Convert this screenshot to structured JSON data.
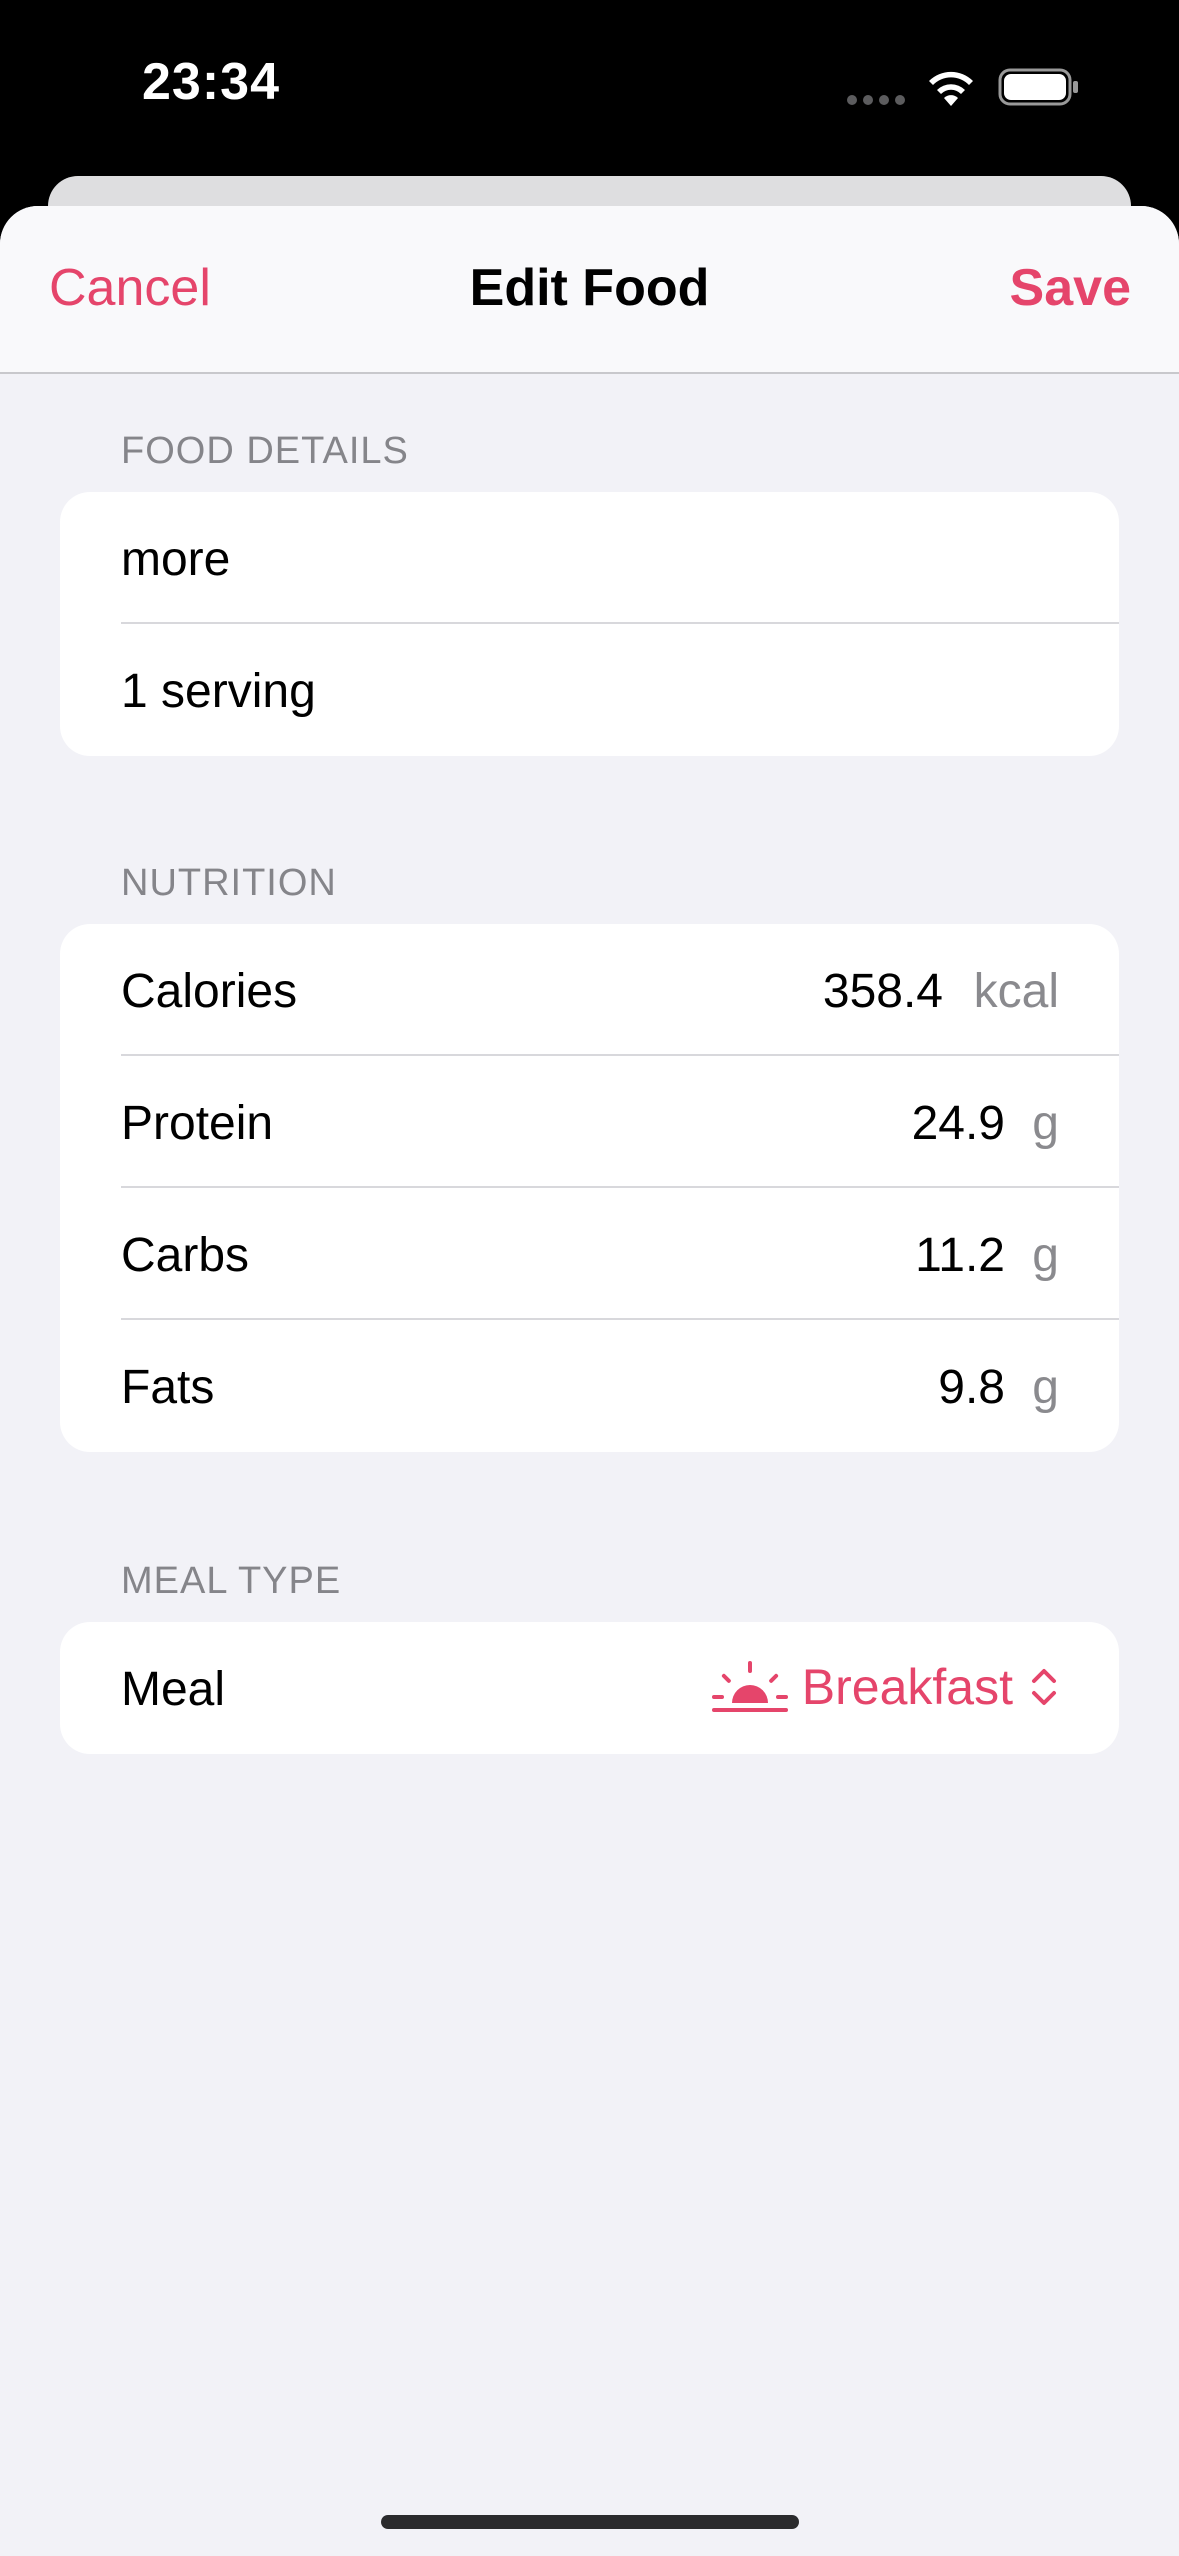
{
  "status_bar": {
    "time": "23:34"
  },
  "nav": {
    "cancel_label": "Cancel",
    "title": "Edit Food",
    "save_label": "Save"
  },
  "food_details": {
    "header": "FOOD DETAILS",
    "name": "more",
    "serving": "1 serving"
  },
  "nutrition": {
    "header": "NUTRITION",
    "rows": [
      {
        "label": "Calories",
        "value": "358.4",
        "unit": "kcal"
      },
      {
        "label": "Protein",
        "value": "24.9",
        "unit": "g"
      },
      {
        "label": "Carbs",
        "value": "11.2",
        "unit": "g"
      },
      {
        "label": "Fats",
        "value": "9.8",
        "unit": "g"
      }
    ]
  },
  "meal_type": {
    "header": "MEAL TYPE",
    "label": "Meal",
    "selected": "Breakfast",
    "icon": "sunrise-icon"
  },
  "colors": {
    "accent": "#e5456b",
    "background": "#f2f2f7"
  }
}
